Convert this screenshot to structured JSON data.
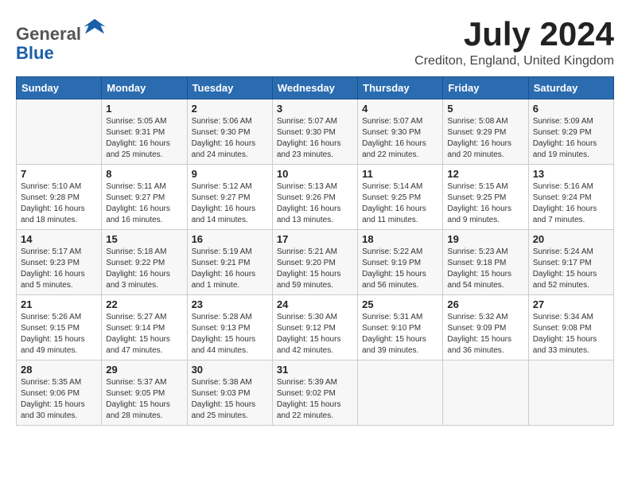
{
  "header": {
    "logo_line1": "General",
    "logo_line2": "Blue",
    "month": "July 2024",
    "location": "Crediton, England, United Kingdom"
  },
  "columns": [
    "Sunday",
    "Monday",
    "Tuesday",
    "Wednesday",
    "Thursday",
    "Friday",
    "Saturday"
  ],
  "weeks": [
    [
      {
        "day": "",
        "empty": true
      },
      {
        "day": "1",
        "sunrise": "5:05 AM",
        "sunset": "9:31 PM",
        "daylight": "16 hours and 25 minutes."
      },
      {
        "day": "2",
        "sunrise": "5:06 AM",
        "sunset": "9:30 PM",
        "daylight": "16 hours and 24 minutes."
      },
      {
        "day": "3",
        "sunrise": "5:07 AM",
        "sunset": "9:30 PM",
        "daylight": "16 hours and 23 minutes."
      },
      {
        "day": "4",
        "sunrise": "5:07 AM",
        "sunset": "9:30 PM",
        "daylight": "16 hours and 22 minutes."
      },
      {
        "day": "5",
        "sunrise": "5:08 AM",
        "sunset": "9:29 PM",
        "daylight": "16 hours and 20 minutes."
      },
      {
        "day": "6",
        "sunrise": "5:09 AM",
        "sunset": "9:29 PM",
        "daylight": "16 hours and 19 minutes."
      }
    ],
    [
      {
        "day": "7",
        "sunrise": "5:10 AM",
        "sunset": "9:28 PM",
        "daylight": "16 hours and 18 minutes."
      },
      {
        "day": "8",
        "sunrise": "5:11 AM",
        "sunset": "9:27 PM",
        "daylight": "16 hours and 16 minutes."
      },
      {
        "day": "9",
        "sunrise": "5:12 AM",
        "sunset": "9:27 PM",
        "daylight": "16 hours and 14 minutes."
      },
      {
        "day": "10",
        "sunrise": "5:13 AM",
        "sunset": "9:26 PM",
        "daylight": "16 hours and 13 minutes."
      },
      {
        "day": "11",
        "sunrise": "5:14 AM",
        "sunset": "9:25 PM",
        "daylight": "16 hours and 11 minutes."
      },
      {
        "day": "12",
        "sunrise": "5:15 AM",
        "sunset": "9:25 PM",
        "daylight": "16 hours and 9 minutes."
      },
      {
        "day": "13",
        "sunrise": "5:16 AM",
        "sunset": "9:24 PM",
        "daylight": "16 hours and 7 minutes."
      }
    ],
    [
      {
        "day": "14",
        "sunrise": "5:17 AM",
        "sunset": "9:23 PM",
        "daylight": "16 hours and 5 minutes."
      },
      {
        "day": "15",
        "sunrise": "5:18 AM",
        "sunset": "9:22 PM",
        "daylight": "16 hours and 3 minutes."
      },
      {
        "day": "16",
        "sunrise": "5:19 AM",
        "sunset": "9:21 PM",
        "daylight": "16 hours and 1 minute."
      },
      {
        "day": "17",
        "sunrise": "5:21 AM",
        "sunset": "9:20 PM",
        "daylight": "15 hours and 59 minutes."
      },
      {
        "day": "18",
        "sunrise": "5:22 AM",
        "sunset": "9:19 PM",
        "daylight": "15 hours and 56 minutes."
      },
      {
        "day": "19",
        "sunrise": "5:23 AM",
        "sunset": "9:18 PM",
        "daylight": "15 hours and 54 minutes."
      },
      {
        "day": "20",
        "sunrise": "5:24 AM",
        "sunset": "9:17 PM",
        "daylight": "15 hours and 52 minutes."
      }
    ],
    [
      {
        "day": "21",
        "sunrise": "5:26 AM",
        "sunset": "9:15 PM",
        "daylight": "15 hours and 49 minutes."
      },
      {
        "day": "22",
        "sunrise": "5:27 AM",
        "sunset": "9:14 PM",
        "daylight": "15 hours and 47 minutes."
      },
      {
        "day": "23",
        "sunrise": "5:28 AM",
        "sunset": "9:13 PM",
        "daylight": "15 hours and 44 minutes."
      },
      {
        "day": "24",
        "sunrise": "5:30 AM",
        "sunset": "9:12 PM",
        "daylight": "15 hours and 42 minutes."
      },
      {
        "day": "25",
        "sunrise": "5:31 AM",
        "sunset": "9:10 PM",
        "daylight": "15 hours and 39 minutes."
      },
      {
        "day": "26",
        "sunrise": "5:32 AM",
        "sunset": "9:09 PM",
        "daylight": "15 hours and 36 minutes."
      },
      {
        "day": "27",
        "sunrise": "5:34 AM",
        "sunset": "9:08 PM",
        "daylight": "15 hours and 33 minutes."
      }
    ],
    [
      {
        "day": "28",
        "sunrise": "5:35 AM",
        "sunset": "9:06 PM",
        "daylight": "15 hours and 30 minutes."
      },
      {
        "day": "29",
        "sunrise": "5:37 AM",
        "sunset": "9:05 PM",
        "daylight": "15 hours and 28 minutes."
      },
      {
        "day": "30",
        "sunrise": "5:38 AM",
        "sunset": "9:03 PM",
        "daylight": "15 hours and 25 minutes."
      },
      {
        "day": "31",
        "sunrise": "5:39 AM",
        "sunset": "9:02 PM",
        "daylight": "15 hours and 22 minutes."
      },
      {
        "day": "",
        "empty": true
      },
      {
        "day": "",
        "empty": true
      },
      {
        "day": "",
        "empty": true
      }
    ]
  ]
}
